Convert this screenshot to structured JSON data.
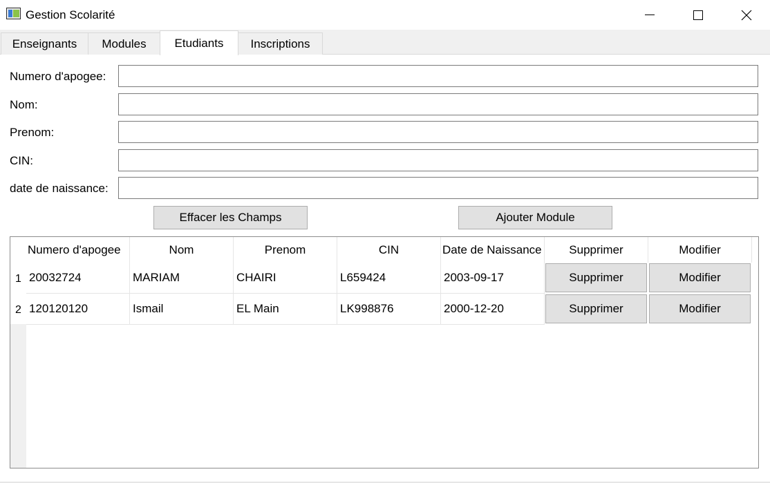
{
  "window": {
    "title": "Gestion Scolarité"
  },
  "tabs": [
    {
      "label": "Enseignants"
    },
    {
      "label": "Modules"
    },
    {
      "label": "Etudiants"
    },
    {
      "label": "Inscriptions"
    }
  ],
  "form": {
    "fields": [
      {
        "label": "Numero d'apogee:",
        "value": ""
      },
      {
        "label": "Nom:",
        "value": ""
      },
      {
        "label": "Prenom:",
        "value": ""
      },
      {
        "label": "CIN:",
        "value": ""
      },
      {
        "label": "date de naissance:",
        "value": ""
      }
    ],
    "clear_button": "Effacer les Champs",
    "add_button": "Ajouter Module"
  },
  "grid": {
    "columns": [
      "Numero d'apogee",
      "Nom",
      "Prenom",
      "CIN",
      "Date de Naissance",
      "Supprimer",
      "Modifier"
    ],
    "rows": [
      {
        "num": "1",
        "apogee": "20032724",
        "nom": "MARIAM",
        "prenom": "CHAIRI",
        "cin": "L659424",
        "naissance": "2003-09-17",
        "delete": "Supprimer",
        "edit": "Modifier"
      },
      {
        "num": "2",
        "apogee": "120120120",
        "nom": "Ismail",
        "prenom": "EL Main",
        "cin": "LK998876",
        "naissance": "2000-12-20",
        "delete": "Supprimer",
        "edit": "Modifier"
      }
    ]
  }
}
